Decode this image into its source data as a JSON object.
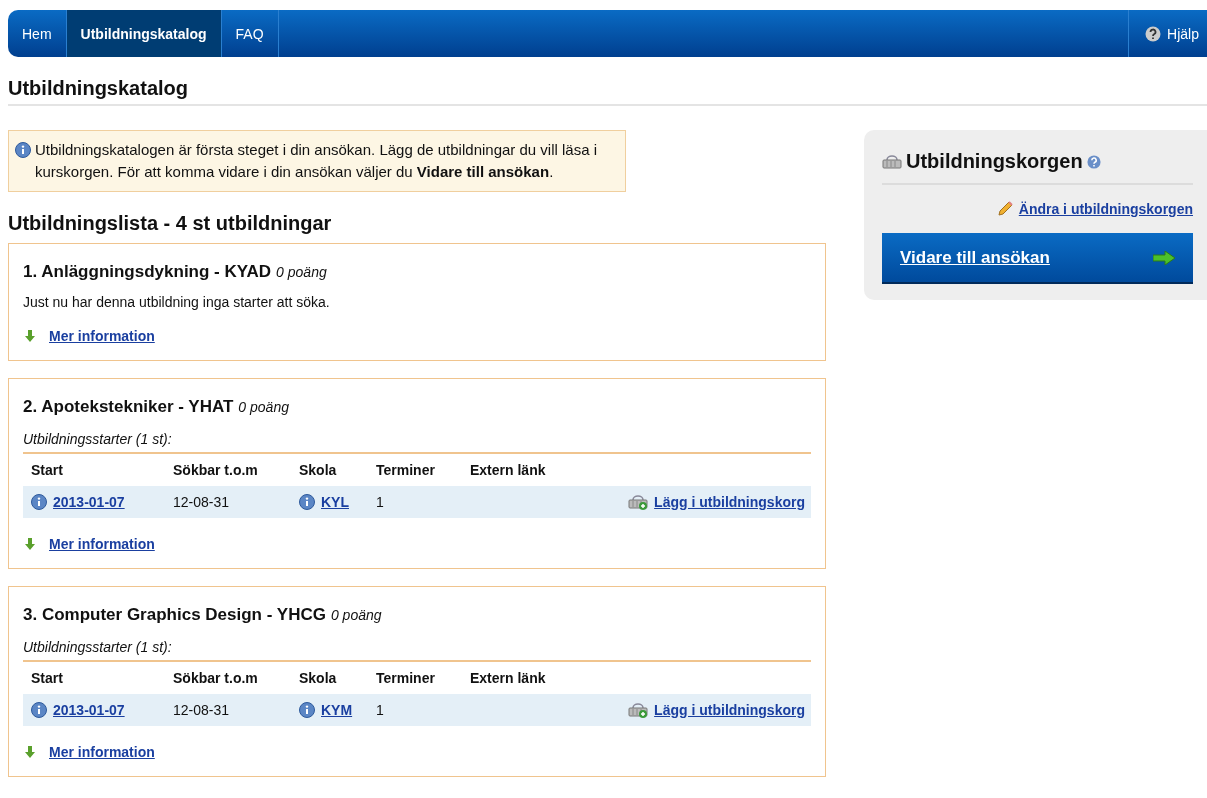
{
  "nav": {
    "items": [
      {
        "label": "Hem",
        "selected": false
      },
      {
        "label": "Utbildningskatalog",
        "selected": true
      },
      {
        "label": "FAQ",
        "selected": false
      }
    ],
    "help": "Hjälp"
  },
  "page_title": "Utbildningskatalog",
  "info_box": {
    "text": "Utbildningskatalogen är första steget i din ansökan. Lägg de utbildningar du vill läsa i kurskorgen. För att komma vidare i din ansökan väljer du **Vidare till ansökan**."
  },
  "list_title": "Utbildningslista - 4 st utbildningar",
  "courses": [
    {
      "title": "1. Anläggningsdykning - KYAD",
      "points": "0 poäng",
      "message": "Just nu har denna utbildning inga starter att söka.",
      "more": "Mer information"
    },
    {
      "title": "2. Apotekstekniker - YHAT",
      "points": "0 poäng",
      "starts_label": "Utbildningsstarter (1 st):",
      "columns": [
        "Start",
        "Sökbar t.o.m",
        "Skola",
        "Terminer",
        "Extern länk"
      ],
      "rows": [
        {
          "start": "2013-01-07",
          "deadline": "12-08-31",
          "school": "KYL",
          "terms": "1",
          "action": "Lägg i utbildningskorg"
        }
      ],
      "more": "Mer information"
    },
    {
      "title": "3. Computer Graphics Design - YHCG",
      "points": "0 poäng",
      "starts_label": "Utbildningsstarter (1 st):",
      "columns": [
        "Start",
        "Sökbar t.o.m",
        "Skola",
        "Terminer",
        "Extern länk"
      ],
      "rows": [
        {
          "start": "2013-01-07",
          "deadline": "12-08-31",
          "school": "KYM",
          "terms": "1",
          "action": "Lägg i utbildningskorg"
        }
      ],
      "more": "Mer information"
    }
  ],
  "sidebar": {
    "title": "Utbildningskorgen",
    "edit_link": "Ändra i utbildningskorgen",
    "proceed_button": "Vidare till ansökan"
  }
}
